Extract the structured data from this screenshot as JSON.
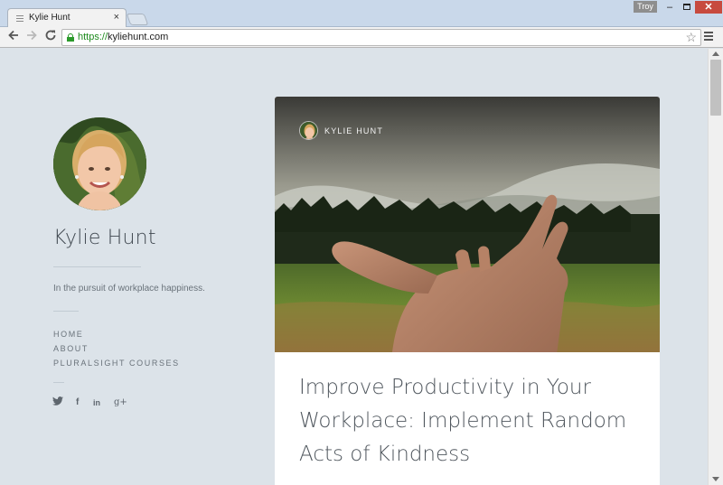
{
  "browser": {
    "tab_title": "Kylie Hunt",
    "tab_close": "×",
    "user": "Troy",
    "window_minimize": "–",
    "window_close": "✕",
    "url_scheme": "https://",
    "url_host": "kyliehunt.com",
    "icons": [
      "back-arrow-icon",
      "forward-arrow-icon",
      "reload-icon",
      "lock-icon",
      "bookmark-star-icon",
      "menu-icon"
    ]
  },
  "sidebar": {
    "name": "Kylie Hunt",
    "tagline": "In the pursuit of workplace happiness.",
    "nav": [
      "HOME",
      "ABOUT",
      "PLURALSIGHT COURSES"
    ],
    "social": [
      {
        "icon": "twitter-icon",
        "glyph": "🐦"
      },
      {
        "icon": "facebook-icon",
        "glyph": "f"
      },
      {
        "icon": "linkedin-icon",
        "glyph": "in"
      },
      {
        "icon": "google-plus-icon",
        "glyph": "g+"
      }
    ]
  },
  "post": {
    "author": "KYLIE HUNT",
    "title": "Improve Productivity in Your Workplace: Implement Random Acts of Kindness"
  },
  "colors": {
    "page_bg": "#dce3e9",
    "secure_green": "#2b9a2b",
    "window_close_red": "#c74a3e"
  }
}
